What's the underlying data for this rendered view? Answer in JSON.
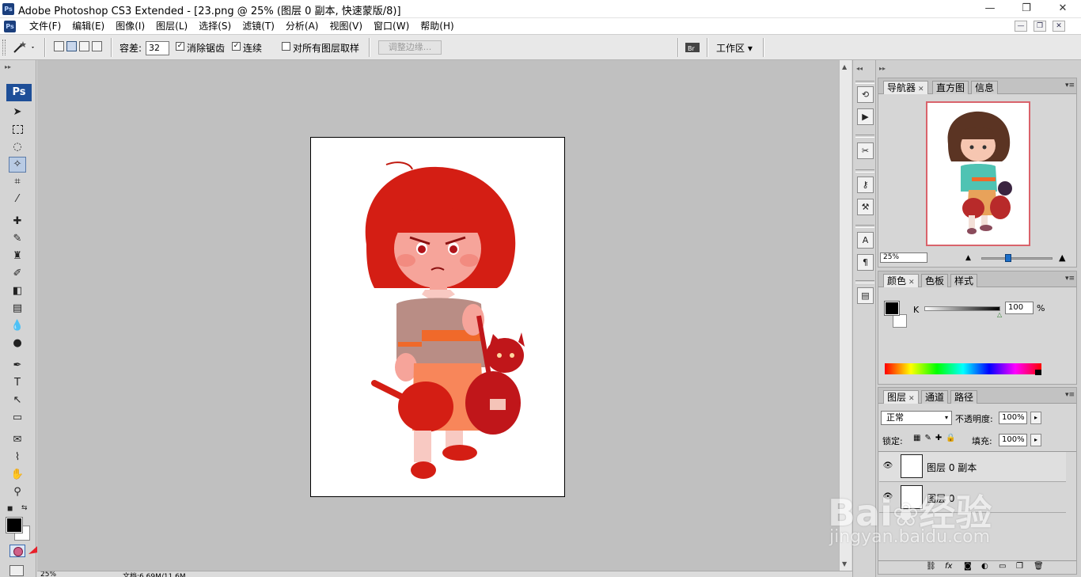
{
  "title_bar": {
    "app_icon": "Ps",
    "title": "Adobe Photoshop CS3 Extended - [23.png @ 25% (图层 0 副本, 快速蒙版/8)]",
    "min": "—",
    "restore": "❐",
    "close": "✕"
  },
  "menu": {
    "items": [
      "文件(F)",
      "编辑(E)",
      "图像(I)",
      "图层(L)",
      "选择(S)",
      "滤镜(T)",
      "分析(A)",
      "视图(V)",
      "窗口(W)",
      "帮助(H)"
    ],
    "doc_min": "—",
    "doc_restore": "❐",
    "doc_close": "✕"
  },
  "options": {
    "tolerance_label": "容差:",
    "tolerance_value": "32",
    "anti_alias_label": "消除锯齿",
    "anti_alias_checked": true,
    "contiguous_label": "连续",
    "contiguous_checked": true,
    "sample_all_label": "对所有图层取样",
    "sample_all_checked": false,
    "refine_edge_label": "调整边缘...",
    "workspace_label": "工作区 ▾"
  },
  "toolbox": {
    "logo": "Ps"
  },
  "status": {
    "zoom": "25%",
    "doc_info": "文档:6.69M/11.6M"
  },
  "navigator": {
    "tabs": [
      "导航器",
      "直方图",
      "信息"
    ],
    "active_tab": "导航器",
    "zoom": "25%"
  },
  "color_panel": {
    "tabs": [
      "颜色",
      "色板",
      "样式"
    ],
    "active_tab": "颜色",
    "channel_label": "K",
    "channel_value": "100",
    "unit": "%"
  },
  "layers_panel": {
    "tabs": [
      "图层",
      "通道",
      "路径"
    ],
    "active_tab": "图层",
    "blend_mode": "正常",
    "opacity_label": "不透明度:",
    "opacity_value": "100%",
    "lock_label": "锁定:",
    "fill_label": "填充:",
    "fill_value": "100%",
    "layers": [
      {
        "name": "图层 0 副本",
        "visible": true,
        "selected": true
      },
      {
        "name": "图层 0",
        "visible": true,
        "selected": false
      }
    ]
  },
  "watermark": {
    "brand": "Bai",
    "brand_cn": "经验",
    "url": "jingyan.baidu.com"
  },
  "colors": {
    "accent_blue": "#1e4f98",
    "nav_frame": "#d9636b",
    "quickmask_red": "#d41e14"
  }
}
